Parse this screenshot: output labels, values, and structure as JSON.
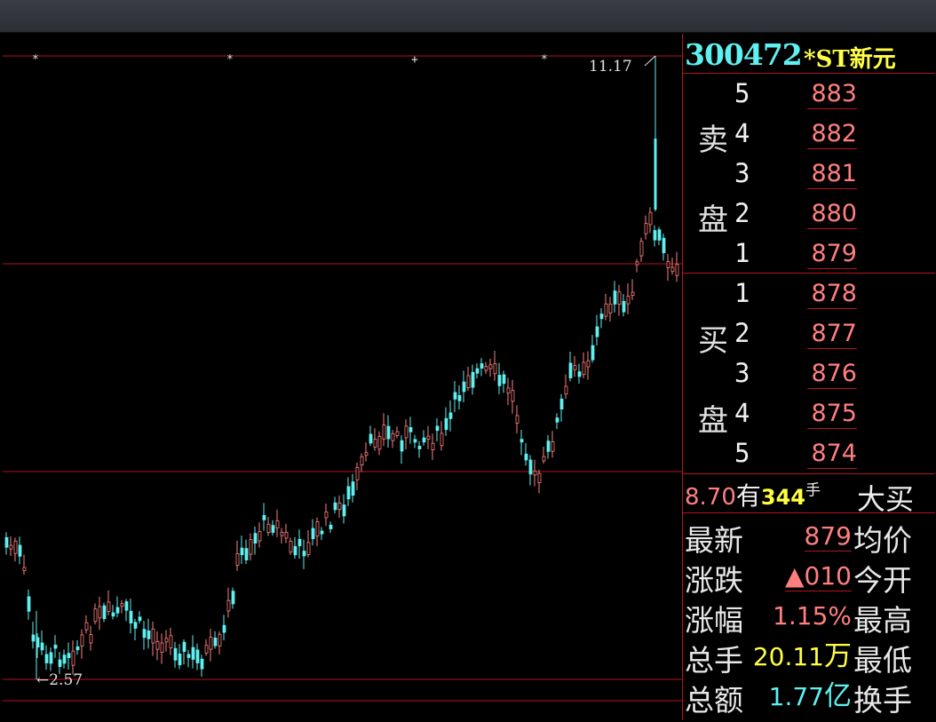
{
  "colors": {
    "background": "#000000",
    "grid": "#b4141e",
    "up": "#ff7f7f",
    "down": "#5ff0f0",
    "code": "#5ff0f0",
    "name": "#ffff44",
    "volume": "#ffff44"
  },
  "chart": {
    "high_label": "11.17",
    "low_label": "←2.57",
    "marker_glyphs": [
      "*",
      "*",
      "+",
      "*"
    ]
  },
  "quote": {
    "code": "300472",
    "name": "*ST新元",
    "sell_label_1": "卖",
    "sell_label_2": "盘",
    "buy_label_1": "买",
    "buy_label_2": "盘",
    "sell": [
      {
        "level": "5",
        "price": "883"
      },
      {
        "level": "4",
        "price": "882"
      },
      {
        "level": "3",
        "price": "881"
      },
      {
        "level": "2",
        "price": "880"
      },
      {
        "level": "1",
        "price": "879"
      }
    ],
    "buy": [
      {
        "level": "1",
        "price": "878"
      },
      {
        "level": "2",
        "price": "877"
      },
      {
        "level": "3",
        "price": "876"
      },
      {
        "level": "4",
        "price": "875"
      },
      {
        "level": "5",
        "price": "874"
      }
    ],
    "trade": {
      "price": "8.70",
      "you": "有",
      "volume": "344",
      "unit": "手",
      "side": "大买"
    },
    "stats": {
      "latest_label": "最新",
      "latest_value": "879",
      "avg_label": "均价",
      "change_label": "涨跌",
      "change_value": "▲010",
      "open_label": "今开",
      "pct_label": "涨幅",
      "pct_value": "1.15%",
      "high_label": "最高",
      "vol_label": "总手",
      "vol_value": "20.11",
      "vol_unit": "万",
      "low_label": "最低",
      "amount_label": "总额",
      "amount_value": "1.77",
      "amount_unit": "亿",
      "turnover_label": "换手"
    }
  }
}
